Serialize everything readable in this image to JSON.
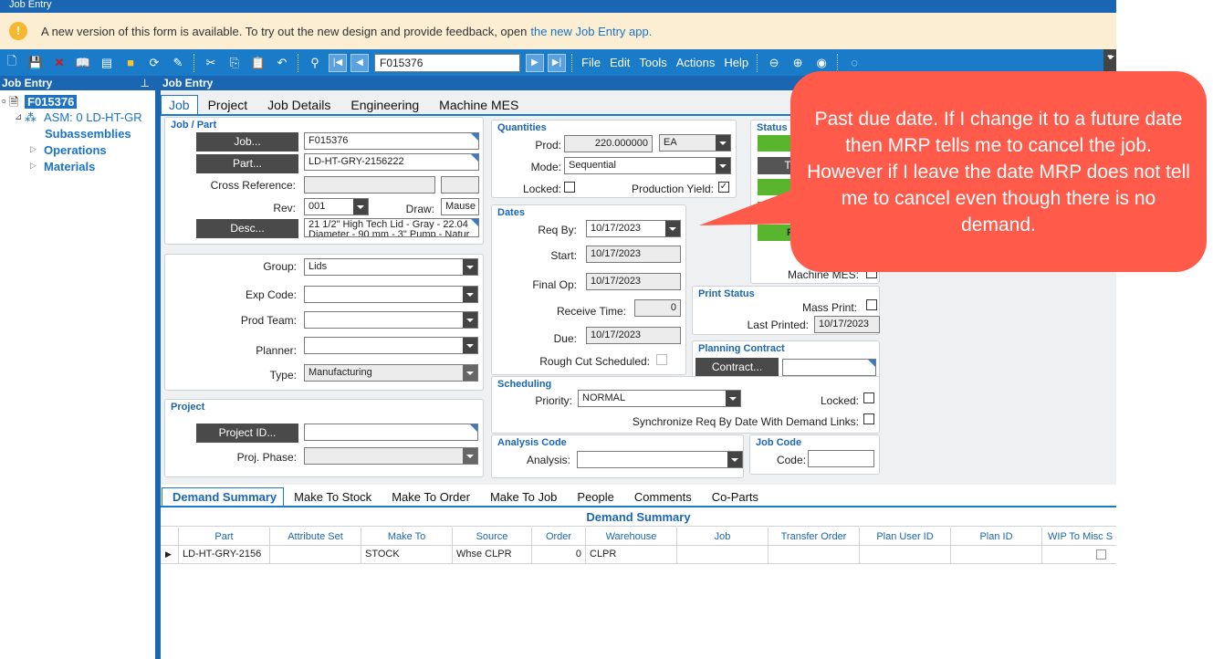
{
  "window": {
    "title": "Job Entry"
  },
  "banner": {
    "text": "A new version of this form is available. To try out the new design and provide feedback, open",
    "link": "the new Job Entry app."
  },
  "toolbar": {
    "job_value": "F015376",
    "menus": [
      "File",
      "Edit",
      "Tools",
      "Actions",
      "Help"
    ]
  },
  "tree": {
    "header": "Job Entry",
    "root": "F015376",
    "asm": "ASM: 0 LD-HT-GR",
    "items": [
      "Subassemblies",
      "Operations",
      "Materials"
    ]
  },
  "main": {
    "header": "Job Entry",
    "tabs": [
      "Job",
      "Project",
      "Job Details",
      "Engineering",
      "Machine MES"
    ]
  },
  "jobpart": {
    "title": "Job / Part",
    "job_btn": "Job...",
    "job_value": "F015376",
    "part_btn": "Part...",
    "part_value": "LD-HT-GRY-2156222",
    "xref_label": "Cross Reference:",
    "rev_label": "Rev:",
    "rev_value": "001",
    "draw_label": "Draw:",
    "draw_value": "Mause",
    "desc_btn": "Desc...",
    "desc_line1": "21 1/2\" High Tech Lid - Gray - 22.04",
    "desc_line2": "Diameter - 90 mm - 3\" Pump - Natur"
  },
  "props": {
    "group_label": "Group:",
    "group_value": "Lids",
    "expcode_label": "Exp Code:",
    "prodteam_label": "Prod Team:",
    "planner_label": "Planner:",
    "type_label": "Type:",
    "type_value": "Manufacturing"
  },
  "project": {
    "title": "Project",
    "btn": "Project ID...",
    "phase_label": "Proj. Phase:"
  },
  "quantities": {
    "title": "Quantities",
    "prod_label": "Prod:",
    "prod_value": "220.000000",
    "uom": "EA",
    "mode_label": "Mode:",
    "mode_value": "Sequential",
    "locked_label": "Locked:",
    "yield_label": "Production Yield:"
  },
  "dates": {
    "title": "Dates",
    "reqby_label": "Req By:",
    "reqby_value": "10/17/2023",
    "start_label": "Start:",
    "start_value": "10/17/2023",
    "finalop_label": "Final Op:",
    "finalop_value": "10/17/2023",
    "receive_label": "Receive Time:",
    "receive_value": "0",
    "due_label": "Due:",
    "due_value": "10/17/2023",
    "roughcut_label": "Rough Cut Scheduled:"
  },
  "status": {
    "title": "Status",
    "t_label": "T",
    "f_label": "F",
    "mes_label": "Machine MES:"
  },
  "print": {
    "title": "Print Status",
    "mass_label": "Mass Print:",
    "last_label": "Last Printed:",
    "last_value": "10/17/2023"
  },
  "planning": {
    "title": "Planning Contract",
    "btn": "Contract..."
  },
  "scheduling": {
    "title": "Scheduling",
    "priority_label": "Priority:",
    "priority_value": "NORMAL",
    "locked_label": "Locked:",
    "sync_label": "Synchronize Req By Date With Demand Links:"
  },
  "analysis": {
    "title": "Analysis Code",
    "label": "Analysis:"
  },
  "jobcode": {
    "title": "Job Code",
    "label": "Code:"
  },
  "bottom": {
    "tabs": [
      "Demand Summary",
      "Make To Stock",
      "Make To Order",
      "Make To Job",
      "People",
      "Comments",
      "Co-Parts"
    ],
    "grid_title": "Demand Summary",
    "columns": [
      "Part",
      "Attribute Set",
      "Make To",
      "Source",
      "Order",
      "Warehouse",
      "Job",
      "Transfer Order",
      "Plan User ID",
      "Plan ID",
      "WIP To Misc S"
    ],
    "row": [
      "LD-HT-GRY-2156",
      "",
      "STOCK",
      "Whse CLPR",
      "0",
      "CLPR",
      "",
      "",
      "",
      "",
      ""
    ]
  },
  "callout": {
    "text": "Past due date.  If I change it to a future date then MRP tells me to cancel the job.  However if I leave the date MRP does not tell me to cancel even though there is no demand."
  }
}
